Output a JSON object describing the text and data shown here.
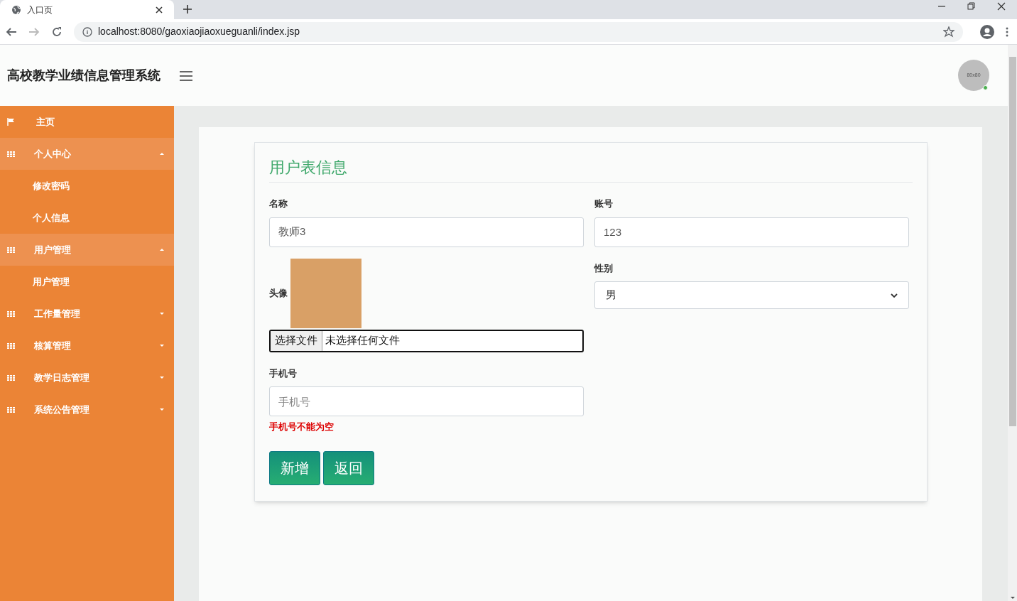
{
  "browser": {
    "tab_title": "入口页",
    "url": "localhost:8080/gaoxiaojiaoxueguanli/index.jsp"
  },
  "header": {
    "title": "高校教学业绩信息管理系统",
    "avatar_label": "80x80"
  },
  "sidebar": {
    "items": [
      {
        "kind": "link",
        "label": "主页"
      },
      {
        "kind": "group",
        "label": "个人中心",
        "expanded": true,
        "children": [
          {
            "label": "修改密码"
          },
          {
            "label": "个人信息"
          }
        ]
      },
      {
        "kind": "group",
        "label": "用户管理",
        "expanded": true,
        "children": [
          {
            "label": "用户管理"
          }
        ]
      },
      {
        "kind": "group",
        "label": "工作量管理",
        "expanded": false
      },
      {
        "kind": "group",
        "label": "核算管理",
        "expanded": false
      },
      {
        "kind": "group",
        "label": "教学日志管理",
        "expanded": false
      },
      {
        "kind": "group",
        "label": "系统公告管理",
        "expanded": false
      }
    ]
  },
  "form": {
    "title": "用户表信息",
    "name": {
      "label": "名称",
      "value": "教师3"
    },
    "account": {
      "label": "账号",
      "value": "123"
    },
    "avatar": {
      "label": "头像",
      "file_button": "选择文件",
      "file_status": "未选择任何文件"
    },
    "gender": {
      "label": "性别",
      "value": "男"
    },
    "phone": {
      "label": "手机号",
      "placeholder": "手机号",
      "error": "手机号不能为空"
    },
    "buttons": [
      "新增",
      "返回"
    ]
  }
}
